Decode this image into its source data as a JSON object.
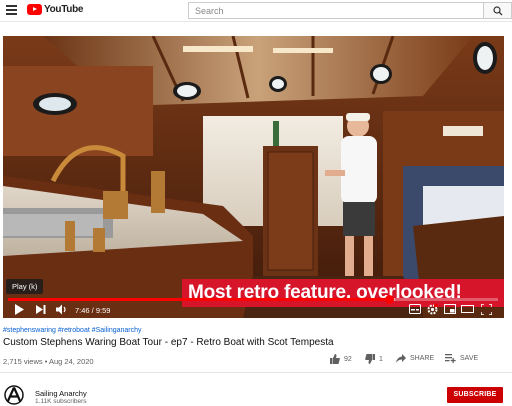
{
  "header": {
    "logo_text": "YouTube",
    "search_placeholder": "Search"
  },
  "player": {
    "caption": "Most retro feature, overlooked!",
    "tooltip": "Play (k)",
    "time_current": "7:46",
    "time_total": "9:59",
    "time_display": "7:46 / 9:59",
    "progress_fraction": 0.778,
    "buffered_fraction": 0.79
  },
  "video": {
    "hashtags": "#stephenswaring #retroboat #Sailinganarchy",
    "title": "Custom Stephens Waring Boat Tour - ep7 - Retro Boat with Scot Tempesta",
    "views_date": "2,715 views • Aug 24, 2020",
    "likes": "92",
    "dislikes": "1",
    "share_label": "SHARE",
    "save_label": "SAVE"
  },
  "channel": {
    "name": "Sailing Anarchy",
    "subscribers": "1.11K subscribers",
    "subscribe_label": "SUBSCRIBE"
  },
  "colors": {
    "accent_red": "#ff0000",
    "caption_red": "#d6152b",
    "subscribe_red": "#cc0000",
    "link_blue": "#065fd4"
  }
}
